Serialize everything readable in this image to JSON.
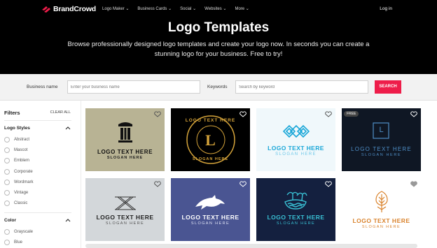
{
  "brand": {
    "name": "BrandCrowd"
  },
  "nav": {
    "items": [
      {
        "label": "Logo Maker"
      },
      {
        "label": "Business Cards"
      },
      {
        "label": "Social"
      },
      {
        "label": "Websites"
      },
      {
        "label": "More"
      }
    ],
    "login": "Log in"
  },
  "hero": {
    "title": "Logo Templates",
    "subtitle": "Browse professionally designed logo templates and create your logo now. In seconds you can create a stunning logo for your business. Free to try!"
  },
  "search": {
    "business_label": "Business name",
    "business_placeholder": "Enter your business name",
    "keyword_label": "Keywords",
    "keyword_placeholder": "Search by keyword",
    "button": "SEARCH"
  },
  "sidebar": {
    "title": "Filters",
    "clear": "CLEAR ALL",
    "logo_styles": {
      "title": "Logo Styles",
      "options": [
        "Abstract",
        "Mascot",
        "Emblem",
        "Corporate",
        "Wordmark",
        "Vintage",
        "Classic"
      ]
    },
    "color": {
      "title": "Color",
      "options": [
        "Grayscale",
        "Blue"
      ]
    }
  },
  "cards": [
    {
      "title": "LOGO TEXT HERE",
      "slogan": "SLOGAN HERE",
      "bg": "#b8b394",
      "icon": "pillar-icon"
    },
    {
      "title": "LOGO TEXT HERE",
      "slogan": "SLOGAN HERE",
      "bg": "#000000",
      "icon": "letter-l-badge-icon",
      "badge_letter": "L"
    },
    {
      "title": "LOGO TEXT HERE",
      "slogan": "SLOGAN HERE",
      "bg": "#f0f8fb",
      "icon": "diamond-pattern-icon"
    },
    {
      "title": "LOGO TEXT HERE",
      "slogan": "SLOGAN HERE",
      "bg": "#0f1724",
      "icon": "square-letter-icon",
      "badge_letter": "L",
      "free_label": "FREE"
    },
    {
      "title": "LOGO TEXT HERE",
      "slogan": "SLOGAN HERE",
      "bg": "#d3d7da",
      "icon": "geometric-x-icon"
    },
    {
      "title": "LOGO TEXT HERE",
      "slogan": "SLOGAN HERE",
      "bg": "#4a5592",
      "icon": "dolphin-icon"
    },
    {
      "title": "LOGO TEXT HERE",
      "slogan": "SLOGAN HERE",
      "bg": "#14203f",
      "icon": "palm-island-icon"
    },
    {
      "title": "LOGO TEXT HERE",
      "slogan": "SLOGAN HERE",
      "bg": "#ffffff",
      "icon": "wheat-icon"
    }
  ],
  "colors": {
    "accent": "#ee1d4a",
    "hero_bg": "#000000"
  }
}
